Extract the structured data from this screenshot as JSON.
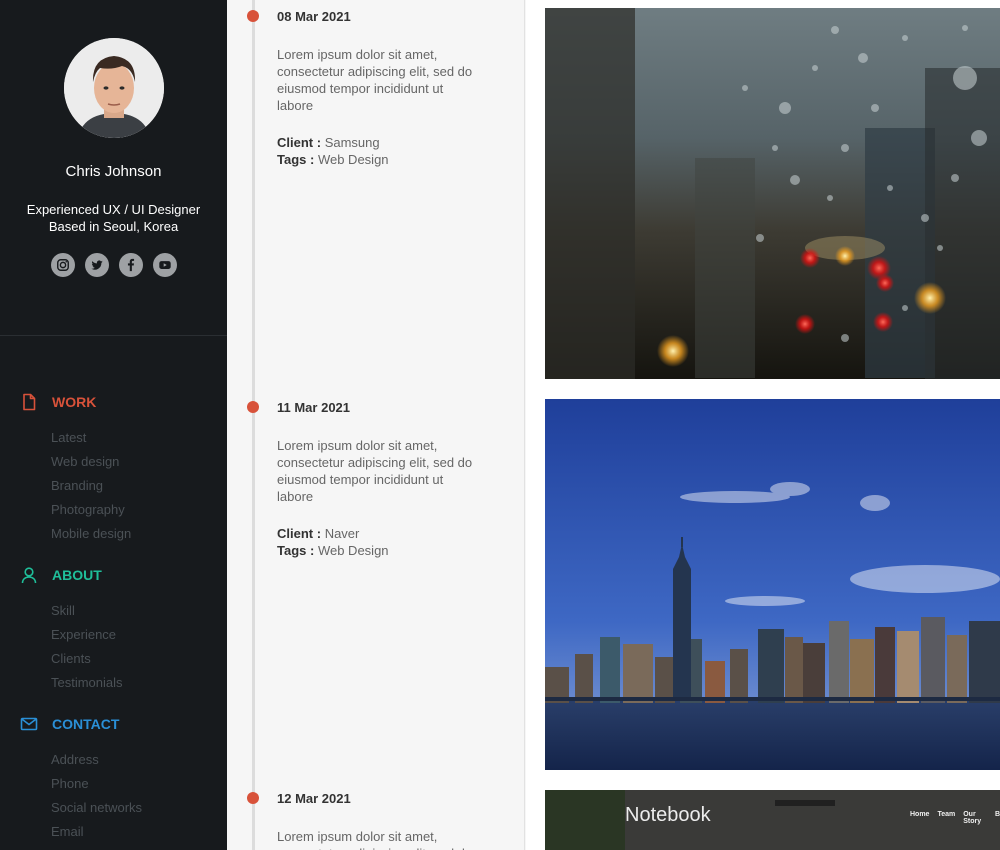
{
  "profile": {
    "name": "Chris Johnson",
    "tagline_line1": "Experienced UX / UI Designer",
    "tagline_line2": "Based in Seoul, Korea",
    "socials": [
      "instagram-icon",
      "twitter-icon",
      "facebook-icon",
      "youtube-icon"
    ]
  },
  "nav": {
    "work": {
      "label": "WORK",
      "color": "#d8523a",
      "items": [
        "Latest",
        "Web design",
        "Branding",
        "Photography",
        "Mobile design"
      ]
    },
    "about": {
      "label": "ABOUT",
      "color": "#1fbf9a",
      "items": [
        "Skill",
        "Experience",
        "Clients",
        "Testimonials"
      ]
    },
    "contact": {
      "label": "CONTACT",
      "color": "#2a8fd6",
      "items": [
        "Address",
        "Phone",
        "Social networks",
        "Email"
      ]
    }
  },
  "timeline": [
    {
      "date": "08 Mar 2021",
      "desc": "Lorem ipsum dolor sit amet, consectetur adipiscing elit, sed do eiusmod tempor incididunt ut labore",
      "client_label": "Client :",
      "client": "Samsung",
      "tags_label": "Tags :",
      "tags": "Web Design"
    },
    {
      "date": "11 Mar 2021",
      "desc": "Lorem ipsum dolor sit amet, consectetur adipiscing elit, sed do eiusmod tempor incididunt ut labore",
      "client_label": "Client :",
      "client": "Naver",
      "tags_label": "Tags :",
      "tags": "Web Design"
    },
    {
      "date": "12 Mar 2021",
      "desc": "Lorem ipsum dolor sit amet, consectetur adipiscing elit, sed do eiusmod tempor incididunt"
    }
  ],
  "gallery": {
    "notebook_title": "Notebook",
    "notebook_nav": [
      "Home",
      "Team",
      "Our Story",
      "B"
    ]
  },
  "colors": {
    "accent": "#d8523a",
    "sidebar_bg": "#171a1d"
  }
}
